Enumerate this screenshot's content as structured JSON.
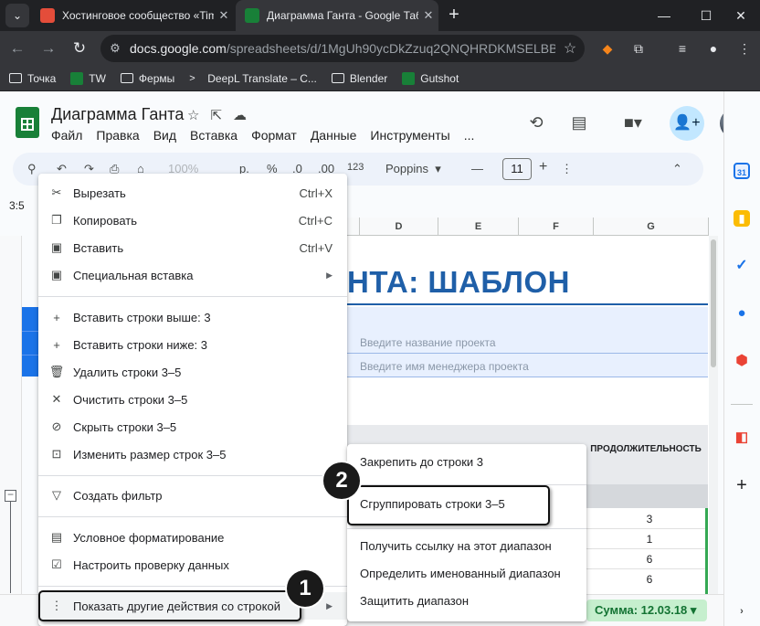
{
  "browser": {
    "tabs": [
      {
        "title": "Хостинговое сообщество «Tim",
        "active": false,
        "favicon_color": "#e44d3a"
      },
      {
        "title": "Диаграмма Ганта - Google Таб",
        "active": true,
        "favicon_color": "#188038"
      }
    ],
    "url_host": "docs.google.com",
    "url_path": "/spreadsheets/d/1MgUh90ycDkZzuq2QNQHRDKMSELBB57...",
    "bookmarks": [
      {
        "label": "Точка",
        "icon": "folder-icon"
      },
      {
        "label": "TW",
        "icon": "sheets-icon"
      },
      {
        "label": "Фермы",
        "icon": "folder-icon"
      },
      {
        "label": "DeepL Translate – С...",
        "icon": "deepl-icon"
      },
      {
        "label": "Blender",
        "icon": "folder-icon"
      },
      {
        "label": "Gutshot",
        "icon": "sheets-icon"
      }
    ]
  },
  "doc": {
    "title": "Диаграмма Ганта",
    "menu": [
      "Файл",
      "Правка",
      "Вид",
      "Вставка",
      "Формат",
      "Данные",
      "Инструменты",
      "..."
    ]
  },
  "format_toolbar": {
    "zoom": "100%",
    "currency": "р.",
    "percent": "%",
    "dec_less": ".0",
    "dec_more": ".00",
    "number_format": "123",
    "font": "Poppins",
    "font_size": "11"
  },
  "sheet": {
    "namebox": "3:5",
    "columns": [
      "D",
      "E",
      "F",
      "G"
    ],
    "big_title": "НТА: ШАБЛОН",
    "project_name_placeholder": "Введите название проекта",
    "manager_placeholder": "Введите имя менеджера проекта",
    "duration_header": "ПРОДОЛЖИТЕЛЬНОСТЬ",
    "duration_values": [
      "3",
      "1",
      "6",
      "6"
    ],
    "sum_label": "Сумма: 12.03.18"
  },
  "context_menu": {
    "items": [
      {
        "label": "Вырезать",
        "shortcut": "Ctrl+X",
        "icon": "scissors-icon"
      },
      {
        "label": "Копировать",
        "shortcut": "Ctrl+C",
        "icon": "copy-icon"
      },
      {
        "label": "Вставить",
        "shortcut": "Ctrl+V",
        "icon": "paste-icon"
      },
      {
        "label": "Специальная вставка",
        "icon": "paste-special-icon"
      },
      {
        "label": "Вставить строки выше: 3",
        "icon": "plus-icon"
      },
      {
        "label": "Вставить строки ниже: 3",
        "icon": "plus-icon"
      },
      {
        "label": "Удалить строки 3–5",
        "icon": "trash-icon"
      },
      {
        "label": "Очистить строки 3–5",
        "icon": "clear-icon"
      },
      {
        "label": "Скрыть строки 3–5",
        "icon": "eye-off-icon"
      },
      {
        "label": "Изменить размер строк 3–5",
        "icon": "resize-icon"
      },
      {
        "label": "Создать фильтр",
        "icon": "filter-icon"
      },
      {
        "label": "Условное форматирование",
        "icon": "paint-icon"
      },
      {
        "label": "Настроить проверку данных",
        "icon": "validation-icon"
      },
      {
        "label": "Показать другие действия со строкой",
        "icon": "more-vert-icon"
      }
    ]
  },
  "submenu": {
    "items": [
      {
        "label": "Закрепить до строки 3"
      },
      {
        "label": "Сгруппировать строки 3–5"
      },
      {
        "label": "Получить ссылку на этот диапазон"
      },
      {
        "label": "Определить именованный диапазон"
      },
      {
        "label": "Защитить диапазон"
      }
    ]
  },
  "annotations": {
    "badge_1": "1",
    "badge_2": "2"
  },
  "colors": {
    "accent": "#1a73e8",
    "title_blue": "#1f5fa8",
    "sum_green": "#c6efce"
  }
}
